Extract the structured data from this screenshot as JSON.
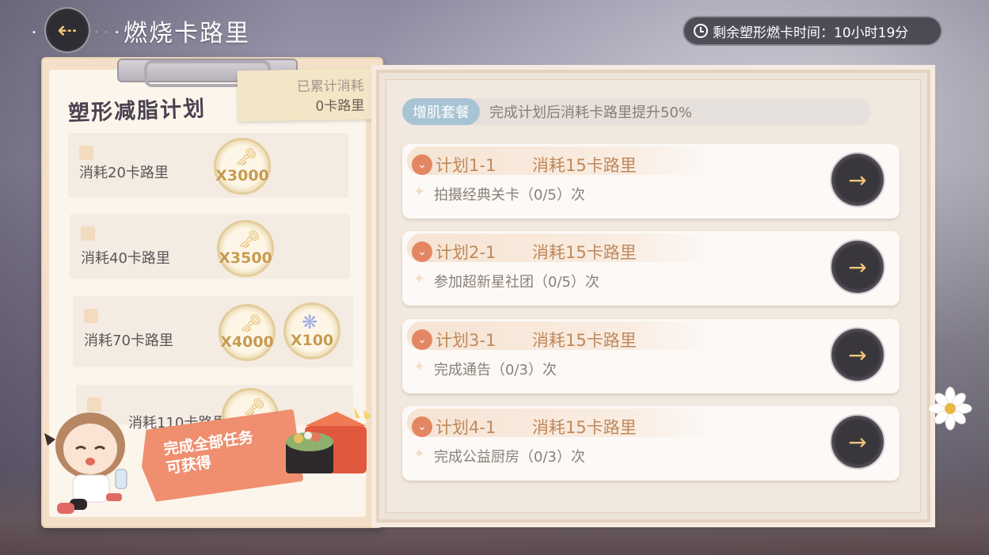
{
  "header": {
    "back_icon": "arrow-left-icon",
    "title": "燃烧卡路里",
    "timer_label": "剩余塑形燃卡时间：10小时19分"
  },
  "plan": {
    "title": "塑形减脂计划",
    "accum_label": "已累计消耗",
    "accum_value": "0卡路里",
    "tiers": [
      {
        "label": "消耗20卡路里",
        "rewards": [
          {
            "icon": "key-coin-icon",
            "qty": "X3000"
          }
        ]
      },
      {
        "label": "消耗40卡路里",
        "rewards": [
          {
            "icon": "key-coin-icon",
            "qty": "X3500"
          }
        ]
      },
      {
        "label": "消耗70卡路里",
        "rewards": [
          {
            "icon": "key-coin-icon",
            "qty": "X4000"
          },
          {
            "icon": "butterfly-icon",
            "qty": "X100"
          }
        ]
      },
      {
        "label": "消耗110卡路里",
        "rewards": [
          {
            "icon": "key-coin-icon",
            "qty": ""
          }
        ]
      }
    ],
    "bubble_line1": "完成全部任务",
    "bubble_line2": "可获得"
  },
  "bonus": {
    "tag": "增肌套餐",
    "text": "完成计划后消耗卡路里提升50%"
  },
  "tasks": [
    {
      "name": "计划1-1",
      "cost": "消耗15卡路里",
      "desc": "拍摄经典关卡（0/5）次"
    },
    {
      "name": "计划2-1",
      "cost": "消耗15卡路里",
      "desc": "参加超新星社团（0/5）次"
    },
    {
      "name": "计划3-1",
      "cost": "消耗15卡路里",
      "desc": "完成通告（0/3）次"
    },
    {
      "name": "计划4-1",
      "cost": "消耗15卡路里",
      "desc": "完成公益厨房（0/3）次"
    }
  ],
  "colors": {
    "accent": "#c0885a",
    "button": "#3a373c",
    "bonus_tag": "#a8c3d4",
    "bubble": "#ef8f70"
  }
}
